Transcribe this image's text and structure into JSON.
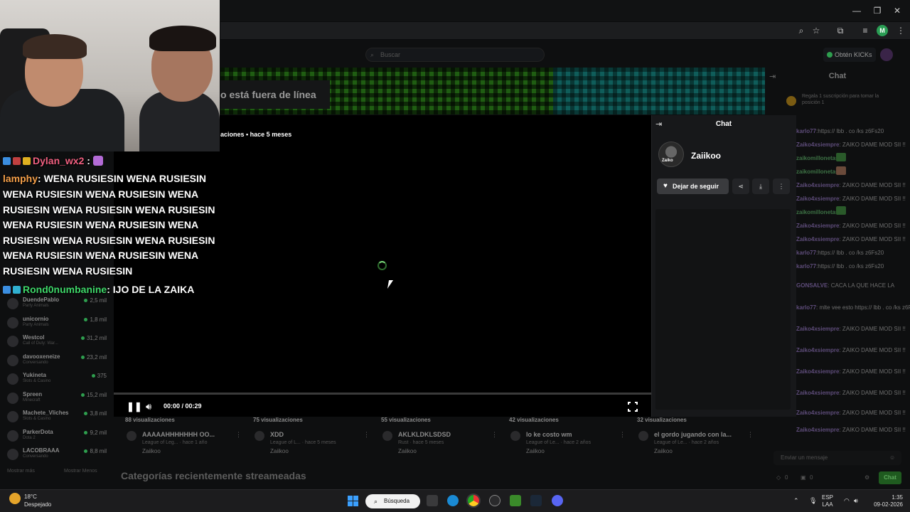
{
  "browser": {
    "window_controls": [
      "—",
      "❐",
      "✕"
    ],
    "profile_initial": "M"
  },
  "site": {
    "search_placeholder": "Buscar",
    "kicks_button": "Obtén KICKs",
    "offline_banner": "o está fuera de línea",
    "views_line": "aciones • hace 5 meses",
    "recent_categories_heading": "Categorías recientemente streameadas",
    "chat": {
      "title": "Chat",
      "sub_message": "Regala 1 suscripción para tomar la posición 1",
      "lines": [
        {
          "user": "karlo77",
          "text": ":https:// lbb . co /ks z6Fs20"
        },
        {
          "user": "Zaiko4xsiempre",
          "text": ": ZAIKO DAME MOD SII !!"
        },
        {
          "user": "zaikomillonetas",
          "text": ":"
        },
        {
          "user": "zaikomillonetas",
          "text": ":"
        },
        {
          "user": "Zaiko4xsiempre",
          "text": ": ZAIKO DAME MOD SII !!"
        },
        {
          "user": "Zaiko4xsiempre",
          "text": ": ZAIKO DAME MOD SII !!"
        },
        {
          "user": "zaikomillonetas",
          "text": ":"
        },
        {
          "user": "Zaiko4xsiempre",
          "text": ": ZAIKO DAME MOD SII !!"
        },
        {
          "user": "Zaiko4xsiempre",
          "text": ": ZAIKO DAME MOD SII !!"
        },
        {
          "user": "karlo77",
          "text": ":https:// lbb . co /ks z6Fs20"
        },
        {
          "user": "karlo77",
          "text": ":https:// lbb . co /ks z6Fs20"
        },
        {
          "user": "GONSALVE",
          "text": ": CACA LA QUE HACE LA"
        },
        {
          "user": "karlo77",
          "text": ": mlte vee esto https:// lbb . co /ks z6Fs20"
        },
        {
          "user": "Zaiko4xsiempre",
          "text": ": ZAIKO DAME MOD SII !!"
        },
        {
          "user": "Zaiko4xsiempre",
          "text": ": ZAIKO DAME MOD SII !!"
        },
        {
          "user": "Zaiko4xsiempre",
          "text": ": ZAIKO DAME MOD SII !!"
        },
        {
          "user": "Zaiko4xsiempre",
          "text": ": ZAIKO DAME MOD SII !!"
        },
        {
          "user": "Zaiko4xsiempre",
          "text": ": ZAIKO DAME MOD SII !!"
        },
        {
          "user": "Zaiko4xsiempre",
          "text": ": ZAIKO DAME MOD SII !!"
        }
      ],
      "input_placeholder": "Enviar un mensaje",
      "send_label": "Chat",
      "stat_1": "0",
      "stat_2": "0"
    },
    "followed": [
      {
        "name": "DuendePablo",
        "sub": "Party Animals",
        "viewers": "2,5 mil"
      },
      {
        "name": "unicornio",
        "sub": "Party Animals",
        "viewers": "1,8 mil"
      },
      {
        "name": "Westcol",
        "sub": "Call of Duty: War...",
        "viewers": "31,2 mil"
      },
      {
        "name": "davooxeneize",
        "sub": "Conversando",
        "viewers": "23,2 mil"
      },
      {
        "name": "Yukineta",
        "sub": "Slots & Casino",
        "viewers": "375"
      },
      {
        "name": "Spreen",
        "sub": "Minecraft",
        "viewers": "15,2 mil"
      },
      {
        "name": "Machete_Vliches",
        "sub": "Slots & Casino",
        "viewers": "3,8 mil"
      },
      {
        "name": "ParkerDota",
        "sub": "Dota 2",
        "viewers": "9,2 mil"
      },
      {
        "name": "LACOBRAAA",
        "sub": "Conversando",
        "viewers": "8,8 mil"
      }
    ],
    "sidebar_more": "Mostrar más",
    "sidebar_less": "Mostrar Menos",
    "videos": [
      {
        "views": "88 visualizaciones",
        "title": "AAAAAHHHHHHH OO...",
        "meta": "League of Leg... · hace 1 año",
        "channel": "Zaiikoo"
      },
      {
        "views": "75 visualizaciones",
        "title": "XDD",
        "meta": "League of L... · hace 5 meses",
        "channel": "Zaiikoo"
      },
      {
        "views": "55 visualizaciones",
        "title": "AKLKLDKLSDSD",
        "meta": "Rust · hace 5 meses",
        "channel": "Zaiikoo"
      },
      {
        "views": "42 visualizaciones",
        "title": "lo ke costo wm",
        "meta": "League of Le... · hace 2 años",
        "channel": "Zaiikoo"
      },
      {
        "views": "32 visualizaciones",
        "title": "el gordo jugando con la...",
        "meta": "League of Le... · hace 2 años",
        "channel": "Zaiikoo"
      }
    ]
  },
  "player": {
    "time": "00:00 / 00:29",
    "progress_fraction": 0.0
  },
  "popup": {
    "title": "Chat",
    "channel_name": "Zaiikoo",
    "avatar_text": "Zaiko",
    "unfollow_label": "Dejar de seguir"
  },
  "overlay_chat": {
    "line1_user": "Dylan_wx2",
    "line1_sep": ":",
    "line2_user": "lamphy",
    "line2_text": ": WENA RUSIESIN WENA RUSIESIN",
    "line3": "WENA RUSIESIN WENA RUSIESIN WENA",
    "line4": "RUSIESIN WENA RUSIESIN WENA RUSIESIN",
    "line5": "WENA RUSIESIN WENA RUSIESIN WENA",
    "line6": "RUSIESIN WENA RUSIESIN WENA RUSIESIN",
    "line7": "WENA RUSIESIN WENA RUSIESIN WENA",
    "line8": "RUSIESIN WENA RUSIESIN",
    "line9_user": "Rond0numbanine",
    "line9_text": ": IJO DE LA ZAIKA"
  },
  "taskbar": {
    "temp": "18°C",
    "weather": "Despejado",
    "search_label": "Búsqueda",
    "lang_1": "ESP",
    "lang_2": "LAA",
    "time": "1:35",
    "date": "09-02-2026"
  },
  "colors": {
    "accent_green": "#52d352",
    "kick_green": "#2e9e4e"
  }
}
